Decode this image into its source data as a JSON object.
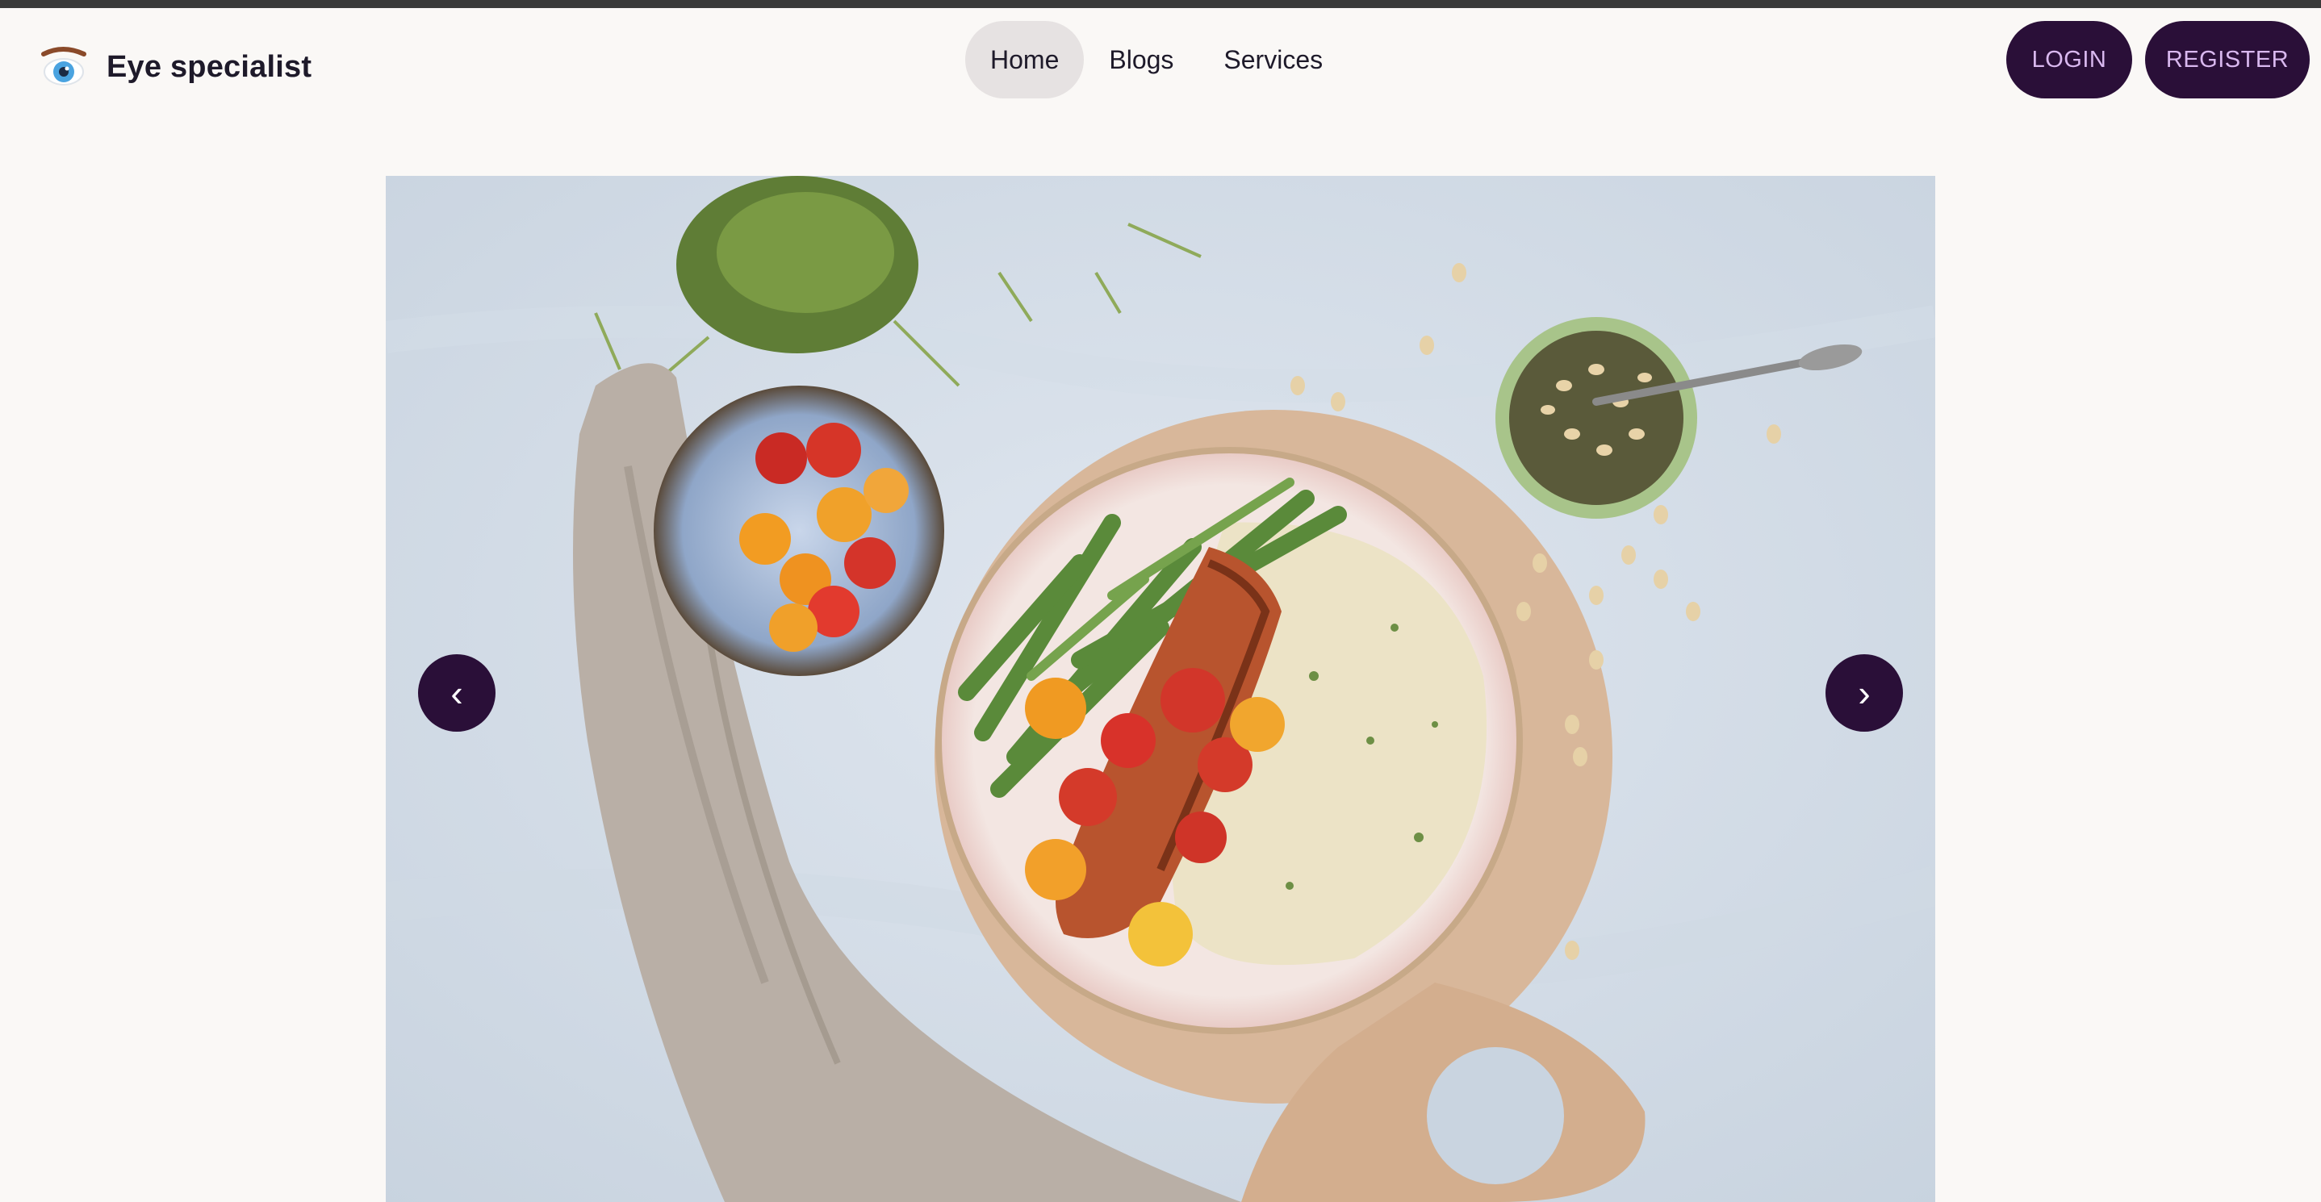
{
  "brand": {
    "name": "Eye specialist",
    "logo_icon": "eye-icon"
  },
  "nav": {
    "items": [
      {
        "label": "Home",
        "active": true
      },
      {
        "label": "Blogs",
        "active": false
      },
      {
        "label": "Services",
        "active": false
      }
    ]
  },
  "auth": {
    "login_label": "LOGIN",
    "register_label": "REGISTER"
  },
  "carousel": {
    "prev_label": "‹",
    "next_label": "›",
    "slide": {
      "image": "food-bowl-photo"
    }
  },
  "colors": {
    "accent": "#2a0f38",
    "accent_text": "#d9b8ef",
    "background": "#faf8f6",
    "nav_active_bg": "#e6e2e2",
    "text": "#1e1a2a"
  }
}
